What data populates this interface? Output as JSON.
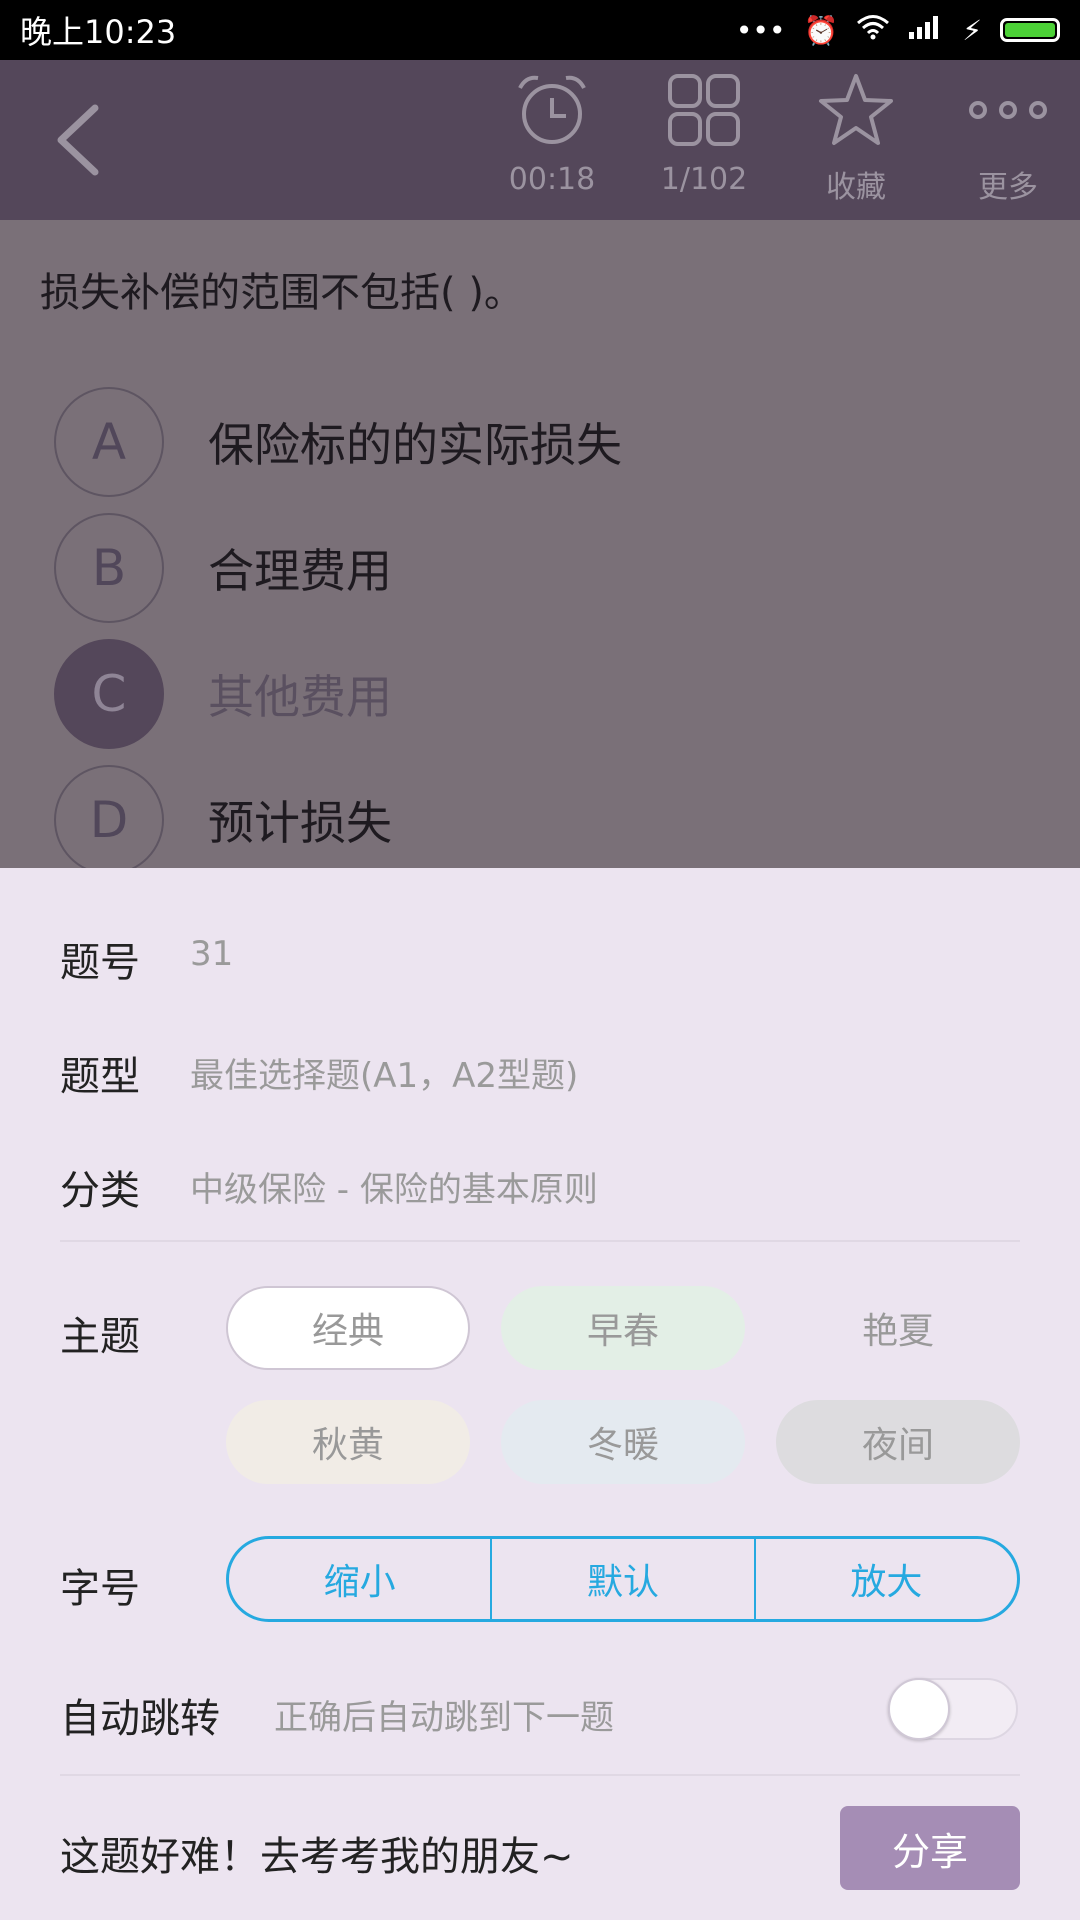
{
  "status_bar": {
    "time": "晚上10:23",
    "icons": [
      "more-dots-icon",
      "alarm-icon",
      "wifi-icon",
      "signal-icon",
      "charging-icon",
      "battery-icon"
    ],
    "battery_level": 1.0
  },
  "toolbar": {
    "timer": "00:18",
    "progress": "1/102",
    "favorite_label": "收藏",
    "more_label": "更多",
    "icons": [
      "back-icon",
      "alarm-clock-icon",
      "grid-icon",
      "star-icon",
      "more-icon"
    ]
  },
  "question": {
    "text": "损失补偿的范围不包括(      )。",
    "options": [
      {
        "letter": "A",
        "text": "保险标的的实际损失"
      },
      {
        "letter": "B",
        "text": "合理费用"
      },
      {
        "letter": "C",
        "text": "其他费用"
      },
      {
        "letter": "D",
        "text": "预计损失"
      }
    ],
    "selected": "C"
  },
  "info": {
    "number_label": "题号",
    "number_value": "31",
    "type_label": "题型",
    "type_value": "最佳选择题(A1，A2型题)",
    "category_label": "分类",
    "category_value": "中级保险 - 保险的基本原则"
  },
  "theme": {
    "label": "主题",
    "options": [
      "经典",
      "早春",
      "艳夏",
      "秋黄",
      "冬暖",
      "夜间"
    ],
    "selected": "经典",
    "colors": {
      "经典": "#ffffff",
      "早春": "#e3efe6",
      "艳夏": "#ece4f0",
      "秋黄": "#f1ece6",
      "冬暖": "#e4eaf0",
      "夜间": "#dddcdf"
    }
  },
  "font_size": {
    "label": "字号",
    "options": [
      "缩小",
      "默认",
      "放大"
    ],
    "accent": "#26a9e0"
  },
  "auto_jump": {
    "label": "自动跳转",
    "desc": "正确后自动跳到下一题",
    "enabled": false
  },
  "share": {
    "prompt": "这题好难！去考考我的朋友~",
    "button": "分享",
    "color": "#a58db5"
  }
}
